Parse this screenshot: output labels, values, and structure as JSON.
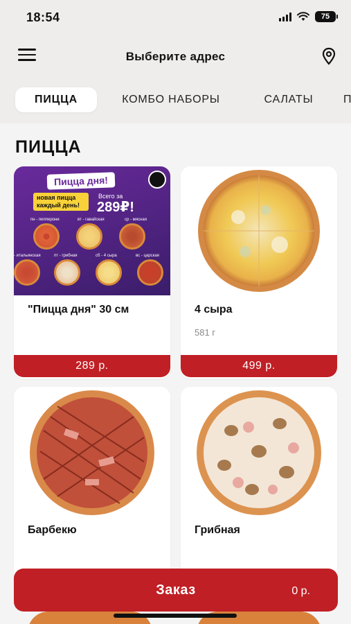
{
  "status_bar": {
    "time": "18:54",
    "battery": "75"
  },
  "header": {
    "title": "Выберите адрес"
  },
  "tabs": [
    {
      "label": "ПИЦЦА",
      "active": true
    },
    {
      "label": "КОМБО НАБОРЫ",
      "active": false
    },
    {
      "label": "САЛАТЫ",
      "active": false
    },
    {
      "label": "П",
      "active": false
    }
  ],
  "section": {
    "title": "ПИЦЦА"
  },
  "promo": {
    "title": "Пицца дня!",
    "badge": "новая пицца каждый день!",
    "price_caption": "Всего за",
    "price": "289₽!",
    "days": [
      "пн - пепперони",
      "вт - гавайская",
      "ср - мясная",
      "- итальянская",
      "пт - грибная",
      "сб - 4 сыра",
      "вс - царская"
    ]
  },
  "products": [
    {
      "name": "\"Пицца дня\" 30 см",
      "weight": "",
      "price": "289 р."
    },
    {
      "name": "4 сыра",
      "weight": "581 г",
      "price": "499 р."
    },
    {
      "name": "Барбекю",
      "weight": "",
      "price": ""
    },
    {
      "name": "Грибная",
      "weight": "",
      "price": ""
    }
  ],
  "order": {
    "label": "Заказ",
    "total": "0 р."
  },
  "colors": {
    "accent": "#c01f25",
    "background": "#efedeb",
    "card": "#ffffff"
  }
}
